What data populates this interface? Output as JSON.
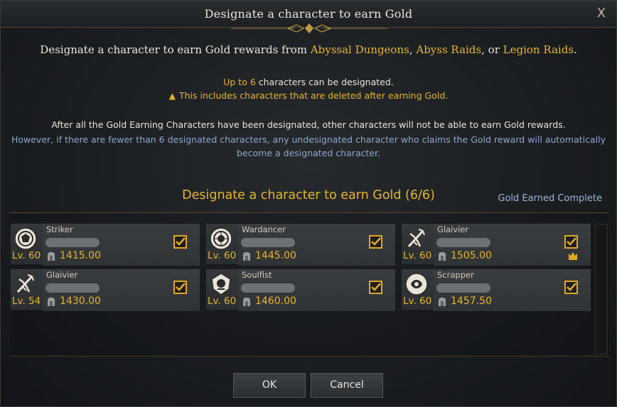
{
  "dialog": {
    "title": "Designate a character to earn Gold",
    "close_glyph": "X",
    "headline_prefix": "Designate a character to earn Gold rewards from ",
    "headline_link1": "Abyssal Dungeons",
    "headline_sep1": ", ",
    "headline_link2": "Abyss Raids",
    "headline_sep2": ", or ",
    "headline_link3": "Legion Raids",
    "headline_suffix": ".",
    "info_upto_prefix": "Up to ",
    "info_upto_count": "6",
    "info_upto_suffix": " characters can be designated.",
    "info_warning": "This includes characters that are deleted after earning Gold.",
    "info_after": "After all the Gold Earning Characters have been designated, other characters will not be able to earn Gold rewards.",
    "info_however_line1": "However, if there are fewer than 6 designated characters, any undesignated character who claims the Gold reward will automatically",
    "info_however_line2": "become a designated character.",
    "section_title": "Designate a character to earn Gold (6/6)",
    "gold_earned_link": "Gold Earned Complete"
  },
  "characters": [
    {
      "class": "Striker",
      "level": "Lv. 60",
      "item_level": "1415.00",
      "checked": true,
      "crown": false,
      "emblem": "striker-emblem-icon"
    },
    {
      "class": "Wardancer",
      "level": "Lv. 60",
      "item_level": "1445.00",
      "checked": true,
      "crown": false,
      "emblem": "wardancer-emblem-icon"
    },
    {
      "class": "Glaivier",
      "level": "Lv. 60",
      "item_level": "1505.00",
      "checked": true,
      "crown": true,
      "emblem": "glaivier-emblem-icon"
    },
    {
      "class": "Glaivier",
      "level": "Lv. 54",
      "item_level": "1430.00",
      "checked": true,
      "crown": false,
      "emblem": "glaivier-emblem-icon"
    },
    {
      "class": "Soulfist",
      "level": "Lv. 60",
      "item_level": "1460.00",
      "checked": true,
      "crown": false,
      "emblem": "soulfist-emblem-icon"
    },
    {
      "class": "Scrapper",
      "level": "Lv. 60",
      "item_level": "1457.50",
      "checked": true,
      "crown": false,
      "emblem": "scrapper-emblem-icon"
    }
  ],
  "buttons": {
    "ok": "OK",
    "cancel": "Cancel"
  },
  "colors": {
    "gold": "#e8b52a",
    "blue_text": "#8ea7cf",
    "link": "#9bb6dd"
  }
}
